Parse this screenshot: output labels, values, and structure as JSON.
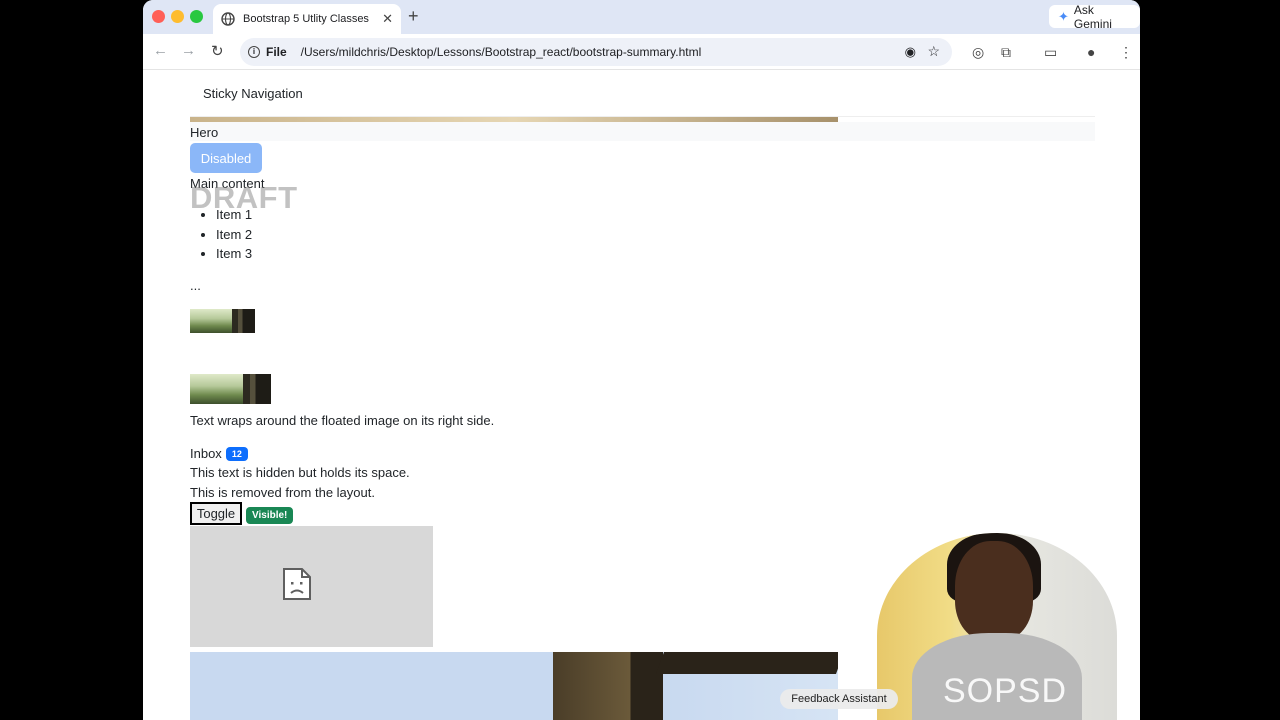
{
  "browser": {
    "tab_title": "Bootstrap 5 Utlity Classes",
    "tab_close": "✕",
    "new_tab": "+",
    "gemini_label": "Ask Gemini",
    "address_scheme": "File",
    "address_url": "/Users/mildchris/Desktop/Lessons/Bootstrap_react/bootstrap-summary.html",
    "icons": [
      "back-icon",
      "forward-icon",
      "reload-icon",
      "info-icon",
      "eye-icon",
      "star-icon",
      "extension-icon",
      "puzzle-icon",
      "cast-icon",
      "profile-icon",
      "menu-icon"
    ]
  },
  "page": {
    "sticky_nav": "Sticky Navigation",
    "hero": "Hero",
    "disabled_button": "Disabled",
    "main_content": "Main content",
    "watermark": "DRAFT",
    "list_items": [
      "Item 1",
      "Item 2",
      "Item 3"
    ],
    "ellipsis": "...",
    "wrap_text": "Text wraps around the floated image on its right side.",
    "inbox_label": "Inbox",
    "inbox_count": "12",
    "hidden_text": "This text is hidden but holds its space.",
    "removed_text": "This is removed from the layout.",
    "toggle_button": "Toggle",
    "visible_badge": "Visible!"
  },
  "overlay": {
    "feedback": "Feedback Assistant",
    "webcam_brand": "SOPSD"
  },
  "colors": {
    "primary": "#0d6efd",
    "success": "#198754",
    "disabled_button": "#8bb7f8"
  }
}
